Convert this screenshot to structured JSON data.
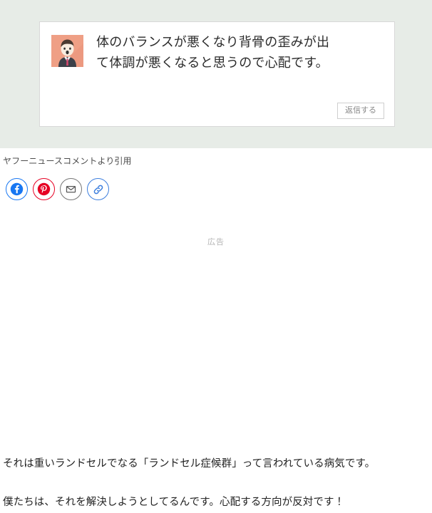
{
  "quote_block": {
    "comment_card": {
      "avatar_alt": "businessman-avatar",
      "comment_text": "体のバランスが悪くなり背骨の歪みが出て体調が悪くなると思うので心配です。",
      "reply_button_label": "返信する"
    },
    "caption": "ヤフーニュースコメントより引用",
    "background_color": "#e7ece7",
    "card_background": "#ffffff"
  },
  "share": {
    "buttons": [
      {
        "name": "facebook",
        "label": "f",
        "color": "#1877f2"
      },
      {
        "name": "pinterest",
        "label": "P",
        "color": "#e60023"
      },
      {
        "name": "email",
        "label": "✉",
        "color": "#767676"
      },
      {
        "name": "link",
        "label": "🔗",
        "color": "#3b7ddd"
      }
    ]
  },
  "ad": {
    "label": "広告"
  },
  "article": {
    "paragraphs": [
      "それは重いランドセルでなる「ランドセル症候群」って言われている病気です。",
      "僕たちは、それを解決しようとしてるんです。心配する方向が反対です！"
    ]
  }
}
